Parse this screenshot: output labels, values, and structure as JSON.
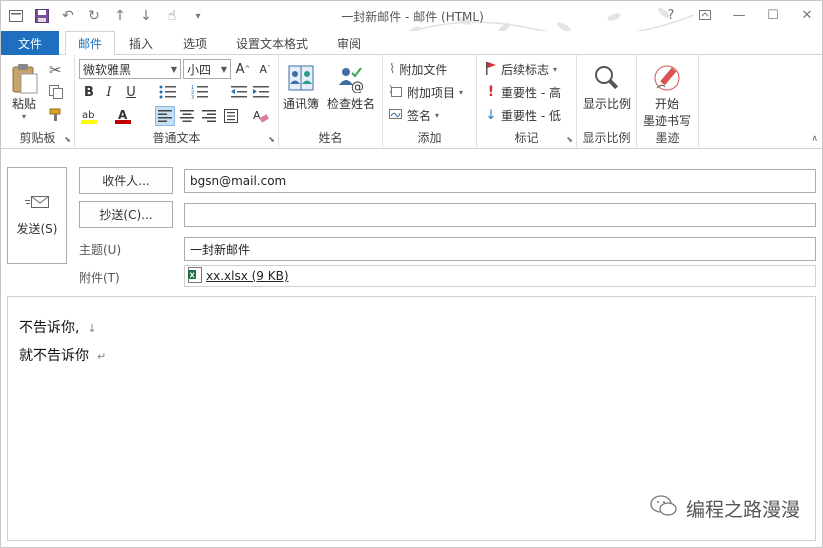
{
  "window": {
    "title": "一封新邮件 - 邮件 (HTML)"
  },
  "tabs": [
    {
      "label": "文件"
    },
    {
      "label": "邮件"
    },
    {
      "label": "插入"
    },
    {
      "label": "选项"
    },
    {
      "label": "设置文本格式"
    },
    {
      "label": "审阅"
    }
  ],
  "ribbon": {
    "clipboard": {
      "paste": "粘贴",
      "label": "剪贴板"
    },
    "basic_text": {
      "font_name": "微软雅黑",
      "font_size": "小四",
      "bold": "B",
      "italic": "I",
      "underline": "U",
      "label": "普通文本"
    },
    "names": {
      "address_book": "通讯簿",
      "check_names": "检查姓名",
      "label": "姓名"
    },
    "include": {
      "attach_file": "附加文件",
      "attach_item": "附加项目",
      "signature": "签名",
      "label": "添加"
    },
    "tags": {
      "follow_up": "后续标志",
      "high_importance": "重要性 - 高",
      "low_importance": "重要性 - 低",
      "label": "标记"
    },
    "zoom": {
      "zoom": "显示比例",
      "label": "显示比例"
    },
    "ink": {
      "start_line1": "开始",
      "start_line2": "墨迹书写",
      "label": "墨迹"
    }
  },
  "compose": {
    "send": "发送(S)",
    "to_button": "收件人...",
    "to_value": "bgsn@mail.com",
    "cc_button": "抄送(C)...",
    "cc_value": "",
    "subject_label": "主题(U)",
    "subject_value": "一封新邮件",
    "attached_label": "附件(T)",
    "attachment": "xx.xlsx (9 KB)",
    "body_lines": [
      "不告诉你,",
      "就不告诉你"
    ]
  },
  "watermark": "编程之路漫漫",
  "colors": {
    "accent": "#1e6fbd",
    "highlight_yellow": "#ffff00",
    "font_red": "#c00000"
  }
}
